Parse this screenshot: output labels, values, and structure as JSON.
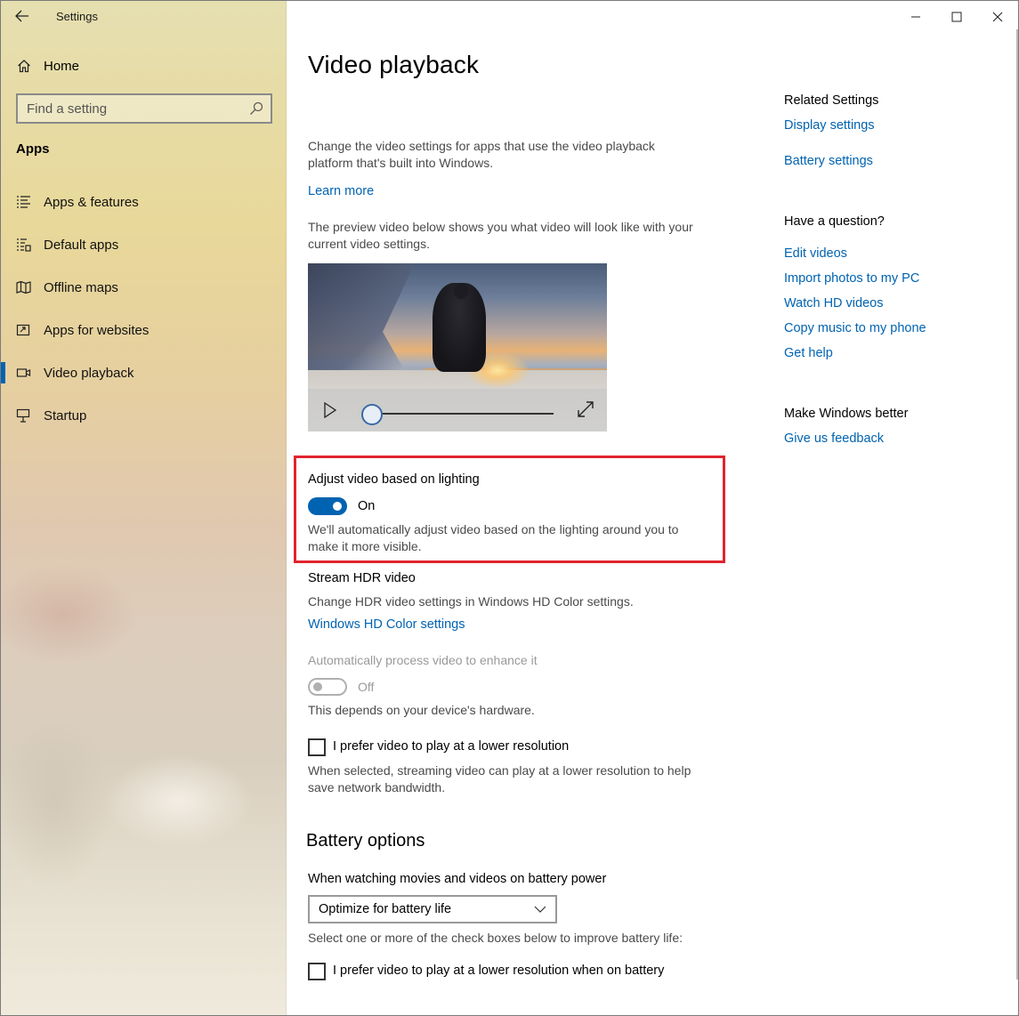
{
  "window": {
    "app_title": "Settings",
    "captions": [
      "minimize",
      "maximize",
      "close"
    ]
  },
  "sidebar": {
    "home_label": "Home",
    "search_placeholder": "Find a setting",
    "section_label": "Apps",
    "items": [
      {
        "label": "Apps & features",
        "icon": "apps-features-icon",
        "active": false
      },
      {
        "label": "Default apps",
        "icon": "default-apps-icon",
        "active": false
      },
      {
        "label": "Offline maps",
        "icon": "offline-maps-icon",
        "active": false
      },
      {
        "label": "Apps for websites",
        "icon": "apps-websites-icon",
        "active": false
      },
      {
        "label": "Video playback",
        "icon": "video-icon",
        "active": true
      },
      {
        "label": "Startup",
        "icon": "startup-icon",
        "active": false
      }
    ]
  },
  "main": {
    "title": "Video playback",
    "intro": "Change the video settings for apps that use the video playback platform that's built into Windows.",
    "learn_more": "Learn more",
    "preview_text": "The preview video below shows you what video will look like with your current video settings.",
    "adjust": {
      "label": "Adjust video based on lighting",
      "state": "On",
      "description": "We'll automatically adjust video based on the lighting around you to make it more visible."
    },
    "hdr": {
      "label": "Stream HDR video",
      "description": "Change HDR video settings in Windows HD Color settings.",
      "link": "Windows HD Color settings"
    },
    "auto_process": {
      "label": "Automatically process video to enhance it",
      "state": "Off",
      "description": "This depends on your device's hardware."
    },
    "lower_res": {
      "label": "I prefer video to play at a lower resolution",
      "description": "When selected, streaming video can play at a lower resolution to help save network bandwidth."
    },
    "battery": {
      "heading": "Battery options",
      "label": "When watching movies and videos on battery power",
      "dropdown_value": "Optimize for battery life",
      "hint": "Select one or more of the check boxes below to improve battery life:",
      "checkbox_label": "I prefer video to play at a lower resolution when on battery"
    }
  },
  "related": {
    "heading": "Related Settings",
    "links": [
      "Display settings",
      "Battery settings"
    ],
    "question_heading": "Have a question?",
    "question_links": [
      "Edit videos",
      "Import photos to my PC",
      "Watch HD videos",
      "Copy music to my phone",
      "Get help"
    ],
    "better_heading": "Make Windows better",
    "feedback_link": "Give us feedback"
  },
  "colors": {
    "accent": "#0063b1",
    "highlight": "#e0242e"
  }
}
